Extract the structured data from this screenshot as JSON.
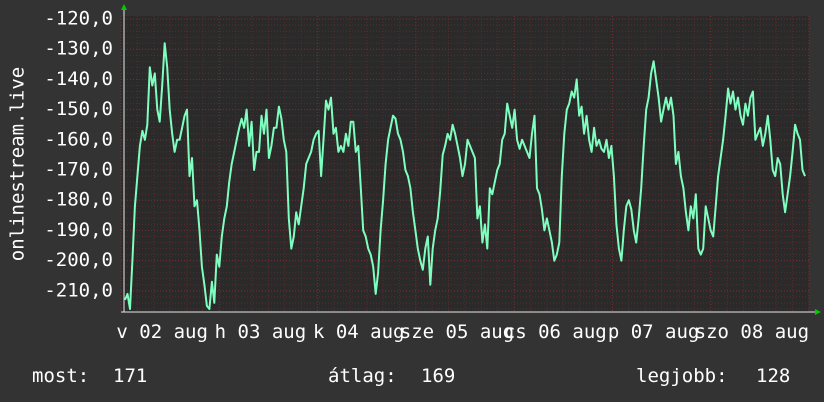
{
  "chart_data": {
    "type": "line",
    "title": "",
    "ylabel": "onlinestream.live",
    "xlabel": "",
    "ylim": [
      -217,
      -119
    ],
    "y_ticks": [
      -120,
      -130,
      -140,
      -150,
      -160,
      -170,
      -180,
      -190,
      -200,
      -210
    ],
    "y_tick_labels": [
      "-120,0",
      "-130,0",
      "-140,0",
      "-150,0",
      "-160,0",
      "-170,0",
      "-180,0",
      "-190,0",
      "-200,0",
      "-210,0"
    ],
    "x_tick_labels": [
      "v 02 aug",
      "h 03 aug",
      "k 04 aug",
      "sze 05 aug",
      "cs 06 aug",
      "p 07 aug",
      "szo 08 aug"
    ],
    "grid": true,
    "colors": {
      "background": "#333333",
      "plot_background": "#2a2a2a",
      "line": "#7fffbf",
      "grid": "#7a2f2f",
      "axis": "#e8e8e8",
      "arrow": "#00cc00"
    },
    "series": [
      {
        "values": [
          -213,
          -211,
          -216,
          -200,
          -182,
          -172,
          -162,
          -157,
          -160,
          -155,
          -136,
          -142,
          -138,
          -150,
          -154,
          -142,
          -128,
          -136,
          -150,
          -158,
          -164,
          -160,
          -160,
          -156,
          -152,
          -150,
          -172,
          -166,
          -182,
          -180,
          -190,
          -202,
          -208,
          -215,
          -216,
          -207,
          -214,
          -198,
          -202,
          -192,
          -186,
          -182,
          -174,
          -168,
          -164,
          -160,
          -156,
          -153,
          -156,
          -150,
          -162,
          -154,
          -170,
          -164,
          -164,
          -152,
          -158,
          -150,
          -166,
          -162,
          -156,
          -156,
          -149,
          -153,
          -160,
          -164,
          -186,
          -196,
          -192,
          -184,
          -188,
          -182,
          -176,
          -168,
          -166,
          -164,
          -160,
          -158,
          -157,
          -172,
          -160,
          -147,
          -150,
          -146,
          -158,
          -156,
          -164,
          -162,
          -164,
          -158,
          -162,
          -154,
          -154,
          -164,
          -162,
          -176,
          -190,
          -192,
          -196,
          -198,
          -202,
          -211,
          -204,
          -190,
          -180,
          -168,
          -160,
          -156,
          -152,
          -153,
          -158,
          -160,
          -164,
          -170,
          -172,
          -176,
          -184,
          -190,
          -196,
          -200,
          -203,
          -196,
          -192,
          -208,
          -196,
          -190,
          -186,
          -177,
          -165,
          -162,
          -158,
          -160,
          -155,
          -158,
          -162,
          -166,
          -172,
          -168,
          -160,
          -162,
          -164,
          -166,
          -186,
          -182,
          -194,
          -188,
          -196,
          -176,
          -178,
          -174,
          -170,
          -168,
          -160,
          -158,
          -148,
          -152,
          -156,
          -150,
          -160,
          -163,
          -160,
          -162,
          -164,
          -166,
          -158,
          -152,
          -176,
          -178,
          -183,
          -190,
          -186,
          -190,
          -194,
          -200,
          -198,
          -194,
          -172,
          -158,
          -150,
          -148,
          -144,
          -146,
          -140,
          -152,
          -149,
          -158,
          -152,
          -160,
          -164,
          -156,
          -162,
          -160,
          -163,
          -164,
          -160,
          -166,
          -162,
          -172,
          -188,
          -196,
          -200,
          -190,
          -182,
          -180,
          -183,
          -190,
          -194,
          -186,
          -176,
          -162,
          -150,
          -146,
          -138,
          -134,
          -140,
          -146,
          -154,
          -150,
          -146,
          -150,
          -146,
          -152,
          -168,
          -164,
          -172,
          -176,
          -184,
          -190,
          -182,
          -186,
          -178,
          -196,
          -198,
          -196,
          -182,
          -186,
          -190,
          -192,
          -182,
          -172,
          -166,
          -160,
          -152,
          -143,
          -148,
          -144,
          -150,
          -146,
          -152,
          -155,
          -148,
          -152,
          -146,
          -144,
          -160,
          -158,
          -156,
          -162,
          -158,
          -152,
          -160,
          -170,
          -172,
          -166,
          -168,
          -178,
          -184,
          -178,
          -172,
          -164,
          -155,
          -158,
          -160,
          -170,
          -172
        ]
      }
    ],
    "stats": [
      {
        "label": "most:",
        "value": "171"
      },
      {
        "label": "átlag:",
        "value": "169"
      },
      {
        "label": "legjobb:",
        "value": "128"
      }
    ]
  }
}
